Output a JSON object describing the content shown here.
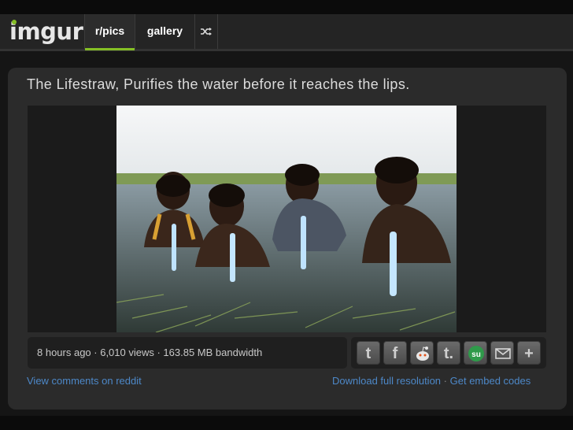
{
  "nav": {
    "logo": "imgur",
    "tabs": [
      {
        "label": "r/pics",
        "active": true
      },
      {
        "label": "gallery",
        "active": false
      }
    ],
    "random_icon": "shuffle-icon"
  },
  "post": {
    "title": "The Lifestraw, Purifies the water before it reaches the lips.",
    "stats": "8 hours ago · 6,010 views · 163.85 MB bandwidth",
    "share_icons": [
      "twitter-icon",
      "facebook-icon",
      "reddit-icon",
      "tumblr-icon",
      "stumbleupon-icon",
      "email-icon",
      "plus-icon"
    ],
    "links": {
      "comments": "View comments on reddit",
      "download": "Download full resolution",
      "separator": "·",
      "embed": "Get embed codes"
    }
  },
  "colors": {
    "accent": "#85bf25",
    "link": "#4d88c8",
    "panel": "#2b2b2b",
    "navbar": "#242424"
  }
}
